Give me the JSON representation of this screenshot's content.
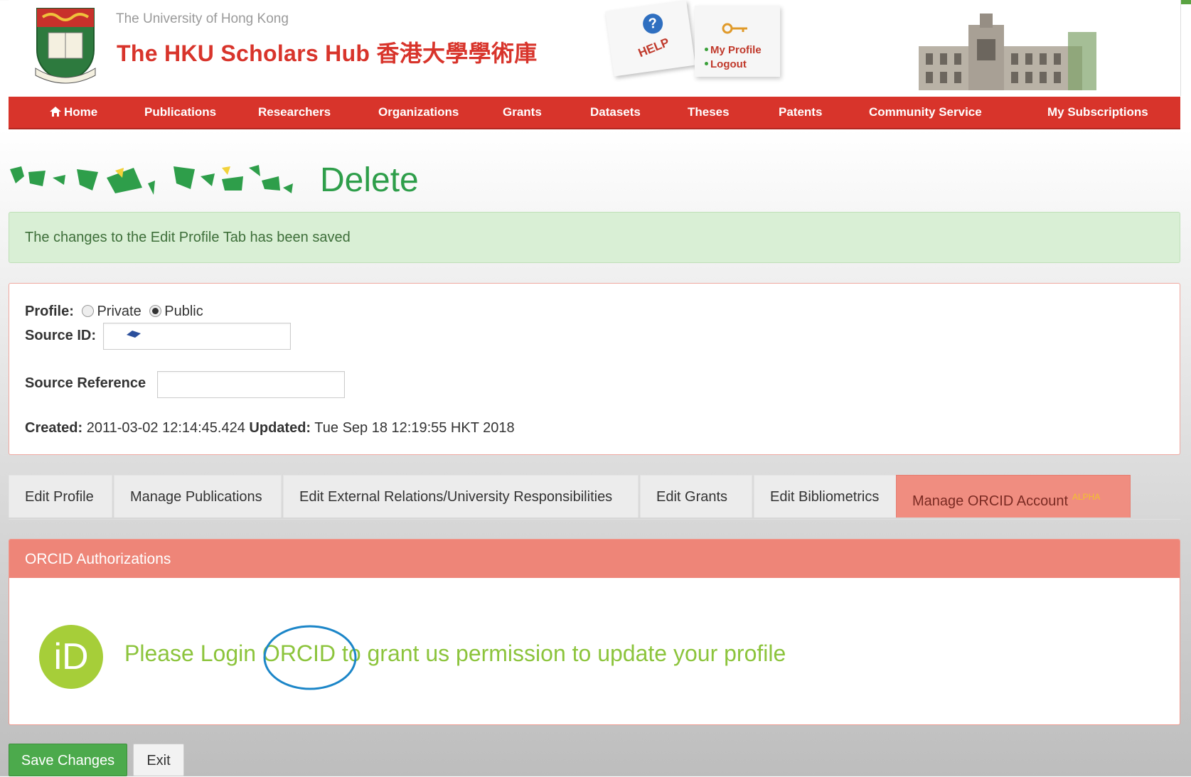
{
  "header": {
    "university": "The University of Hong Kong",
    "hub_title": "The HKU Scholars Hub 香港大學學術庫",
    "help_label": "HELP",
    "my_profile_label": "My Profile",
    "logout_label": "Logout"
  },
  "nav": {
    "items": [
      {
        "label": "Home"
      },
      {
        "label": "Publications"
      },
      {
        "label": "Researchers"
      },
      {
        "label": "Organizations"
      },
      {
        "label": "Grants"
      },
      {
        "label": "Datasets"
      },
      {
        "label": "Theses"
      },
      {
        "label": "Patents"
      },
      {
        "label": "Community Service"
      },
      {
        "label": "My Subscriptions"
      }
    ]
  },
  "page": {
    "title_suffix": "Delete",
    "alert": "The changes to the Edit Profile Tab has been saved"
  },
  "profile": {
    "profile_label": "Profile:",
    "private_label": "Private",
    "public_label": "Public",
    "selected": "Public",
    "source_id_label": "Source ID:",
    "source_id_value": "",
    "source_ref_label": "Source Reference",
    "source_ref_value": "",
    "created_label": "Created:",
    "created_value": "2011-03-02 12:14:45.424",
    "updated_label": "Updated:",
    "updated_value": "Tue Sep 18 12:19:55 HKT 2018"
  },
  "tabs": [
    {
      "label": "Edit Profile"
    },
    {
      "label": "Manage Publications"
    },
    {
      "label": "Edit External Relations/University Responsibilities"
    },
    {
      "label": "Edit Grants"
    },
    {
      "label": "Edit Bibliometrics"
    },
    {
      "label": "Manage ORCID Account",
      "badge": "ALPHA",
      "active": true
    }
  ],
  "orcid": {
    "header": "ORCID Authorizations",
    "logo_text": "iD",
    "message_before": "Please Login ",
    "message_link": "ORCID",
    "message_after": " to grant us permission to update your profile"
  },
  "buttons": {
    "save": "Save Changes",
    "exit": "Exit"
  },
  "colors": {
    "brand_red": "#d8342b",
    "orcid_green": "#a6ce39",
    "tab_active": "#f08d80",
    "save_green": "#4caa4c"
  }
}
